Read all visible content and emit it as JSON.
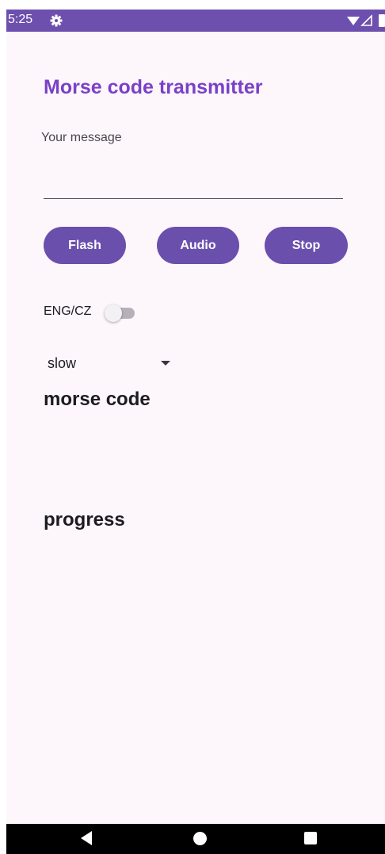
{
  "status_bar": {
    "time": "5:25",
    "background": "#6d4fae",
    "icons": [
      "gear-icon",
      "wifi-icon",
      "signal-icon",
      "battery-icon"
    ]
  },
  "app": {
    "title": "Morse code transmitter",
    "title_color": "#7b40c8",
    "background": "#fdf7fc"
  },
  "message": {
    "label": "Your message",
    "value": "",
    "placeholder": ""
  },
  "buttons": {
    "flash": "Flash",
    "audio": "Audio",
    "stop": "Stop",
    "color": "#6b4fad"
  },
  "language_switch": {
    "label": "ENG/CZ",
    "checked": false
  },
  "speed": {
    "selected": "slow"
  },
  "sections": {
    "morse_code": "morse code",
    "progress": "progress"
  },
  "nav_bar": {
    "icons": [
      "back-icon",
      "home-icon",
      "recents-icon"
    ]
  }
}
